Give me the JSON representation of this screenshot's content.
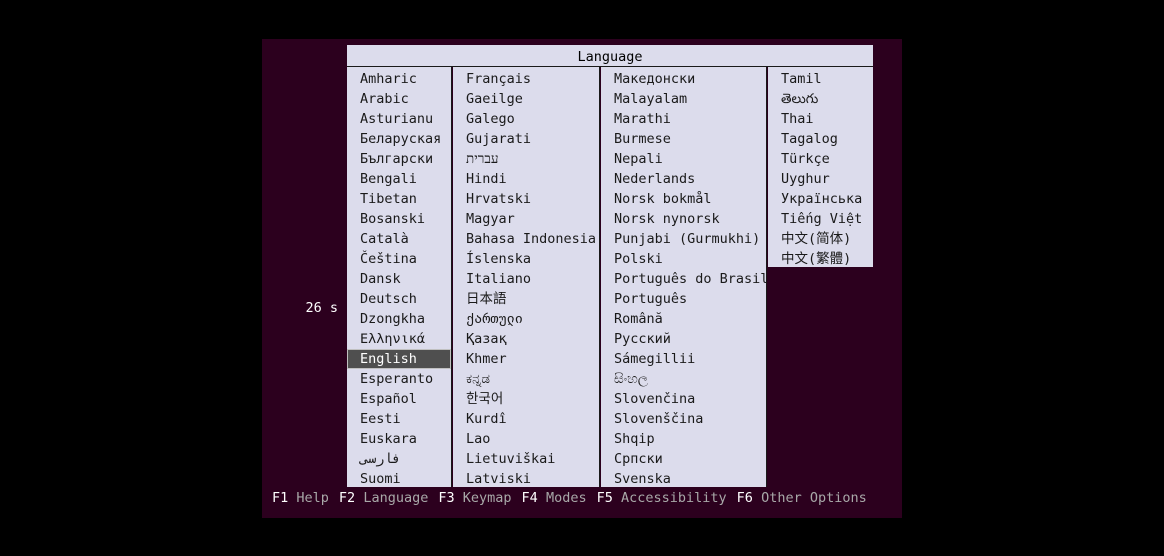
{
  "dialog": {
    "title": "Language",
    "columns": [
      [
        "Amharic",
        "Arabic",
        "Asturianu",
        "Беларуская",
        "Български",
        "Bengali",
        "Tibetan",
        "Bosanski",
        "Català",
        "Čeština",
        "Dansk",
        "Deutsch",
        "Dzongkha",
        "Ελληνικά",
        "English",
        "Esperanto",
        "Español",
        "Eesti",
        "Euskara",
        "فارسی",
        "Suomi"
      ],
      [
        "Français",
        "Gaeilge",
        "Galego",
        "Gujarati",
        "עברית",
        "Hindi",
        "Hrvatski",
        "Magyar",
        "Bahasa Indonesia",
        "Íslenska",
        "Italiano",
        "日本語",
        "ქართული",
        "Қазақ",
        "Khmer",
        "ಕನ್ನಡ",
        "한국어",
        "Kurdî",
        "Lao",
        "Lietuviškai",
        "Latviski"
      ],
      [
        "Македонски",
        "Malayalam",
        "Marathi",
        "Burmese",
        "Nepali",
        "Nederlands",
        "Norsk bokmål",
        "Norsk nynorsk",
        "Punjabi (Gurmukhi)",
        "Polski",
        "Português do Brasil",
        "Português",
        "Română",
        "Русский",
        "Sámegillii",
        "සිංහල",
        "Slovenčina",
        "Slovenščina",
        "Shqip",
        "Српски",
        "Svenska"
      ],
      [
        "Tamil",
        "తెలుగు",
        "Thai",
        "Tagalog",
        "Türkçe",
        "Uyghur",
        "Українська",
        "Tiếng Việt",
        "中文(简体)",
        "中文(繁體)"
      ]
    ],
    "selected": "English"
  },
  "countdown": "26 s",
  "footer": [
    {
      "key": "F1",
      "label": "Help"
    },
    {
      "key": "F2",
      "label": "Language"
    },
    {
      "key": "F3",
      "label": "Keymap"
    },
    {
      "key": "F4",
      "label": "Modes"
    },
    {
      "key": "F5",
      "label": "Accessibility"
    },
    {
      "key": "F6",
      "label": "Other Options"
    }
  ],
  "colors": {
    "background": "#2c001e",
    "dialog": "#dcdcec",
    "selected": "#4f4f4f"
  }
}
